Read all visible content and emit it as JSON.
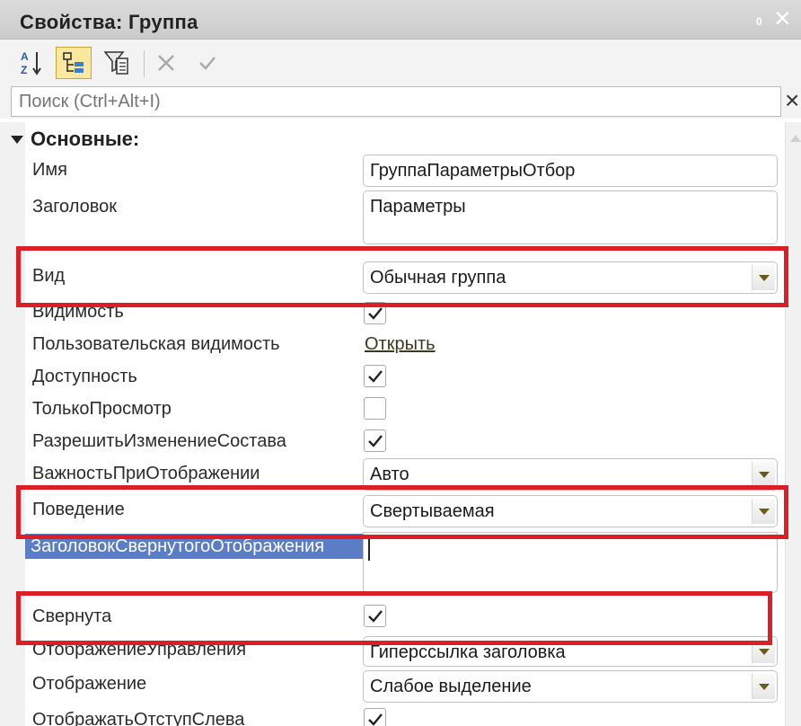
{
  "window": {
    "title": "Свойства: Группа",
    "pin_label": "0",
    "close_label": "×"
  },
  "toolbar": {
    "sort_icon": "sort-alphabetical-icon",
    "categorized_icon": "categorized-icon",
    "filter_icon": "filter-icon",
    "cancel_icon": "cancel-icon",
    "apply_icon": "apply-checkmark-icon"
  },
  "search": {
    "placeholder": "Поиск (Ctrl+Alt+I)",
    "clear_label": "×"
  },
  "section": {
    "title": "Основные:"
  },
  "properties": {
    "name": {
      "label": "Имя",
      "value": "ГруппаПараметрыОтбор"
    },
    "caption": {
      "label": "Заголовок",
      "value": "Параметры"
    },
    "kind": {
      "label": "Вид",
      "value": "Обычная группа"
    },
    "visible": {
      "label": "Видимость",
      "checked": true
    },
    "user_visibility": {
      "label": "Пользовательская видимость",
      "link": "Открыть"
    },
    "enabled": {
      "label": "Доступность",
      "checked": true
    },
    "read_only": {
      "label": "ТолькоПросмотр",
      "checked": false
    },
    "allow_change_composition": {
      "label": "РазрешитьИзменениеСостава",
      "checked": true
    },
    "display_importance": {
      "label": "ВажностьПриОтображении",
      "value": "Авто"
    },
    "behavior": {
      "label": "Поведение",
      "value": "Свертываемая"
    },
    "collapsed_caption": {
      "label": "ЗаголовокСвернутогоОтображения",
      "value": ""
    },
    "collapsed": {
      "label": "Свернута",
      "checked": true
    },
    "control_representation": {
      "label": "ОтображениеУправления",
      "value": "Гиперссылка заголовка"
    },
    "representation": {
      "label": "Отображение",
      "value": "Слабое выделение"
    },
    "show_left_margin": {
      "label": "ОтображатьОтступСлева",
      "checked": true
    }
  },
  "colors": {
    "highlight_box": "#dc1f26",
    "selection": "#5b7dc6"
  }
}
